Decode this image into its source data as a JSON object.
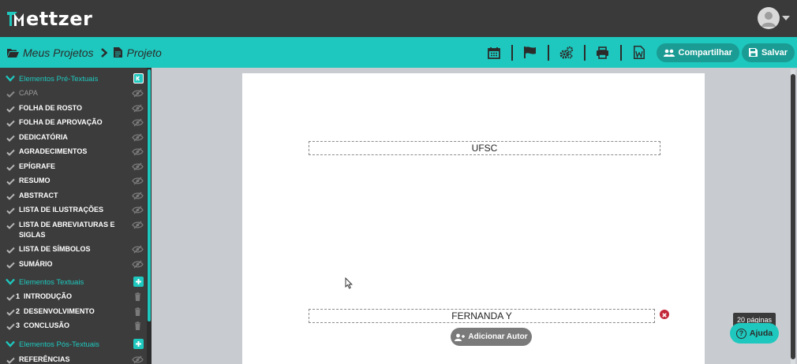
{
  "app": {
    "logo_text": "ettzer",
    "logo_letter": "M"
  },
  "breadcrumb": {
    "projects_label": "Meus Projetos",
    "current_label": "Projeto"
  },
  "toolbar": {
    "icons": [
      "calendar-icon",
      "flag-icon",
      "settings-gears-icon",
      "print-icon",
      "word-export-icon"
    ],
    "share_label": "Compartilhar",
    "save_label": "Salvar"
  },
  "sidebar": {
    "pre_textual": {
      "title": "Elementos Pré-Textuais",
      "items": [
        {
          "label": "CAPA",
          "dimmed": true
        },
        {
          "label": "FOLHA DE ROSTO"
        },
        {
          "label": "FOLHA DE APROVAÇÃO"
        },
        {
          "label": "DEDICATÓRIA"
        },
        {
          "label": "AGRADECIMENTOS"
        },
        {
          "label": "EPÍGRAFE"
        },
        {
          "label": "RESUMO"
        },
        {
          "label": "ABSTRACT"
        },
        {
          "label": "LISTA DE ILUSTRAÇÕES"
        },
        {
          "label": "LISTA DE ABREVIATURAS E SIGLAS"
        },
        {
          "label": "LISTA DE SÍMBOLOS"
        },
        {
          "label": "SUMÁRIO"
        }
      ]
    },
    "textual": {
      "title": "Elementos Textuais",
      "items": [
        {
          "num": "1",
          "label": "INTRODUÇÃO"
        },
        {
          "num": "2",
          "label": "DESENVOLVIMENTO"
        },
        {
          "num": "3",
          "label": "CONCLUSÃO"
        }
      ]
    },
    "post_textual": {
      "title": "Elementos Pós-Textuais",
      "items": [
        {
          "label": "REFERÊNCIAS"
        }
      ]
    }
  },
  "document": {
    "institution": "UFSC",
    "author": "FERNANDA  Y",
    "add_author_label": "Adicionar Autor"
  },
  "status": {
    "pages_label": "20 páginas",
    "help_label": "Ajuda"
  },
  "colors": {
    "accent": "#1ec8be",
    "topbar": "#3a3a3a",
    "sidebar": "#3c3c3c",
    "remove": "#c2283a"
  }
}
